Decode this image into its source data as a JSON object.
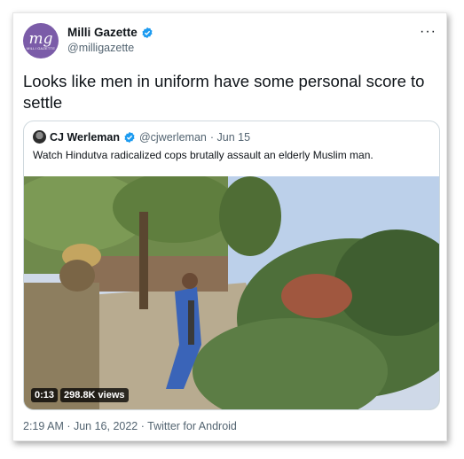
{
  "tweet": {
    "author_name": "Milli Gazette",
    "author_handle": "@milligazette",
    "avatar_letters": "mg",
    "avatar_subtext": "MILLI GAZETTE",
    "text": "Looks like men in uniform have some personal score to settle",
    "more_icon": "···",
    "footer": "2:19 AM · Jun 16, 2022 · Twitter for Android"
  },
  "quoted": {
    "author_name": "CJ Werleman",
    "author_handle": "@cjwerleman",
    "date": "· Jun 15",
    "text": "Watch Hindutva radicalized cops brutally assault an elderly Muslim man.",
    "video": {
      "duration": "0:13",
      "views": "298.8K views"
    }
  },
  "colors": {
    "verified": "#1d9bf0",
    "avatar_bg": "#7b5ca8",
    "secondary_text": "#536471",
    "border": "#cfd9de"
  },
  "icons": [
    "verified-badge-icon",
    "more-icon"
  ]
}
